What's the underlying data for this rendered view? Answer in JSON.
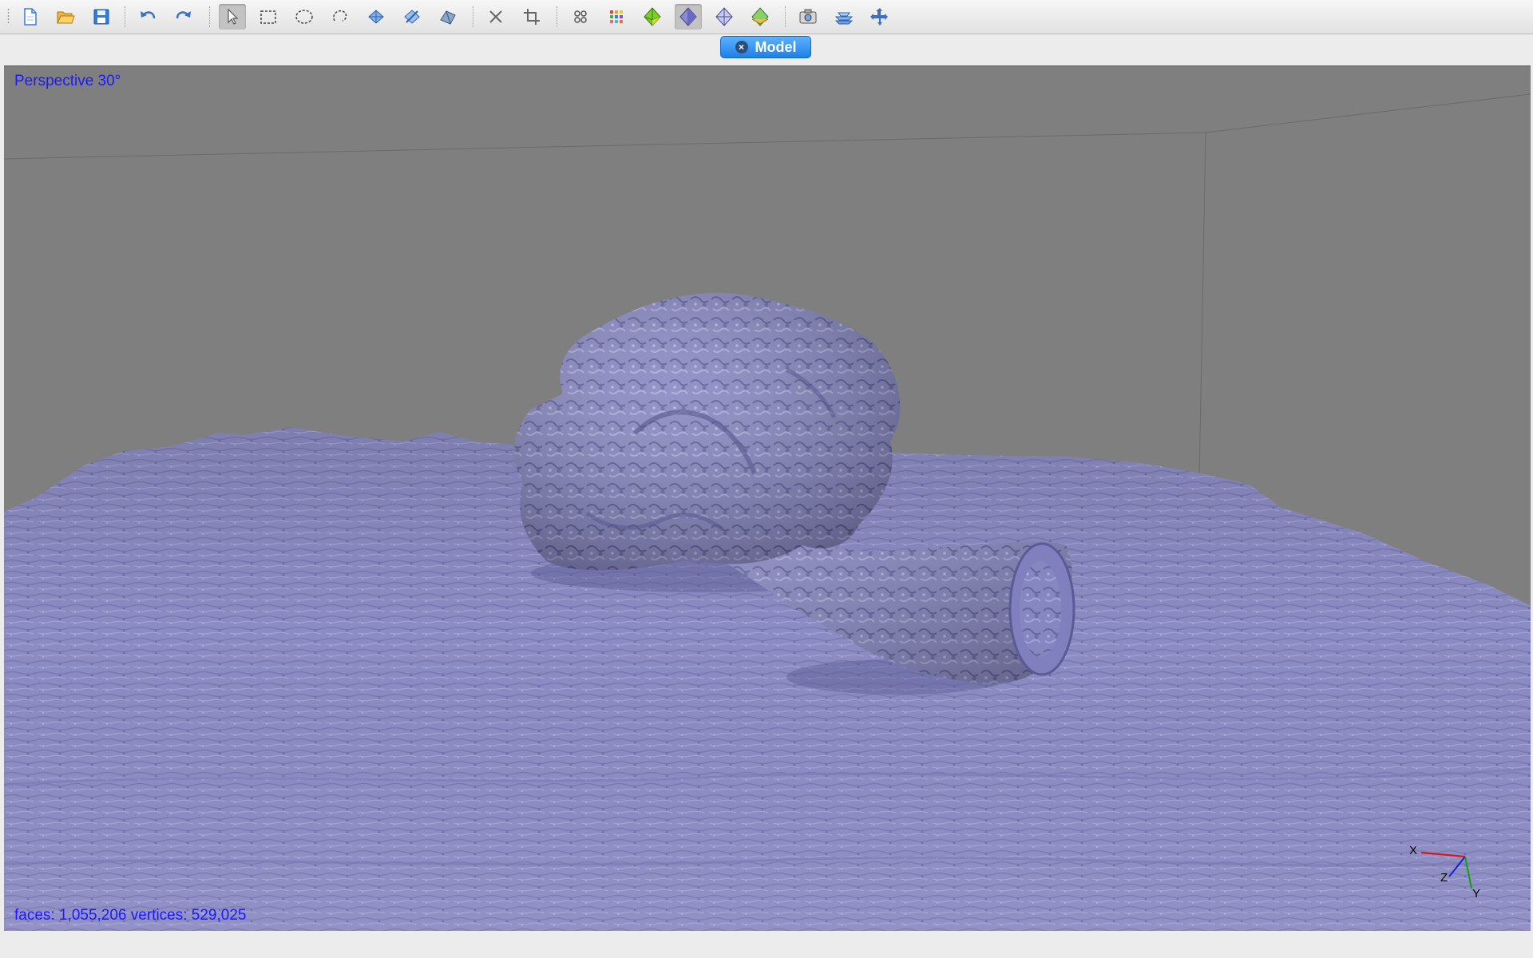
{
  "toolbar": {
    "buttons": [
      {
        "name": "new-file",
        "icon": "new-document-icon",
        "active": false
      },
      {
        "name": "open-file",
        "icon": "folder-open-icon",
        "active": false
      },
      {
        "name": "save-file",
        "icon": "floppy-disk-icon",
        "active": false
      },
      {
        "name": "undo",
        "icon": "undo-arrow-icon",
        "active": false
      },
      {
        "name": "redo",
        "icon": "redo-arrow-icon",
        "active": false
      },
      {
        "name": "select-pointer",
        "icon": "pointer-arrow-icon",
        "active": true
      },
      {
        "name": "rectangle-select",
        "icon": "dashed-rectangle-icon",
        "active": false
      },
      {
        "name": "ellipse-select",
        "icon": "dashed-ellipse-icon",
        "active": false
      },
      {
        "name": "lasso-select",
        "icon": "lasso-icon",
        "active": false
      },
      {
        "name": "select-connected",
        "icon": "mesh-select-icon",
        "active": false
      },
      {
        "name": "paint-select",
        "icon": "brush-select-icon",
        "active": false
      },
      {
        "name": "select-by-angle",
        "icon": "mesh-shape-icon",
        "active": false
      },
      {
        "name": "delete",
        "icon": "close-x-icon",
        "active": false
      },
      {
        "name": "crop",
        "icon": "crop-icon",
        "active": false
      },
      {
        "name": "view-points",
        "icon": "points-icon",
        "active": false
      },
      {
        "name": "view-colored-points",
        "icon": "colored-points-icon",
        "active": false
      },
      {
        "name": "view-textured",
        "icon": "green-diamond-icon",
        "active": false
      },
      {
        "name": "view-solid",
        "icon": "solid-diamond-icon",
        "active": true
      },
      {
        "name": "view-wireframe",
        "icon": "wireframe-diamond-icon",
        "active": false
      },
      {
        "name": "view-shaded-texture",
        "icon": "shaded-diamond-icon",
        "active": false
      },
      {
        "name": "capture-view",
        "icon": "camera-icon",
        "active": false
      },
      {
        "name": "show-layers",
        "icon": "stacked-layers-icon",
        "active": false
      },
      {
        "name": "navigation-mode",
        "icon": "move-arrows-icon",
        "active": false
      }
    ]
  },
  "tab": {
    "label": "Model",
    "close_glyph": "×"
  },
  "viewport": {
    "projection_label": "Perspective 30°",
    "stats_label": "faces: 1,055,206 vertices: 529,025",
    "axes": {
      "x": "X",
      "y": "Y",
      "z": "Z"
    },
    "background_color": "#7f7f7f",
    "model_color": "#8c8cc4"
  },
  "colors": {
    "label_blue": "#1a1aff",
    "tab_blue": "#2b8cf5",
    "axis_x": "#e01010",
    "axis_y": "#10a010",
    "axis_z": "#1020e0"
  }
}
